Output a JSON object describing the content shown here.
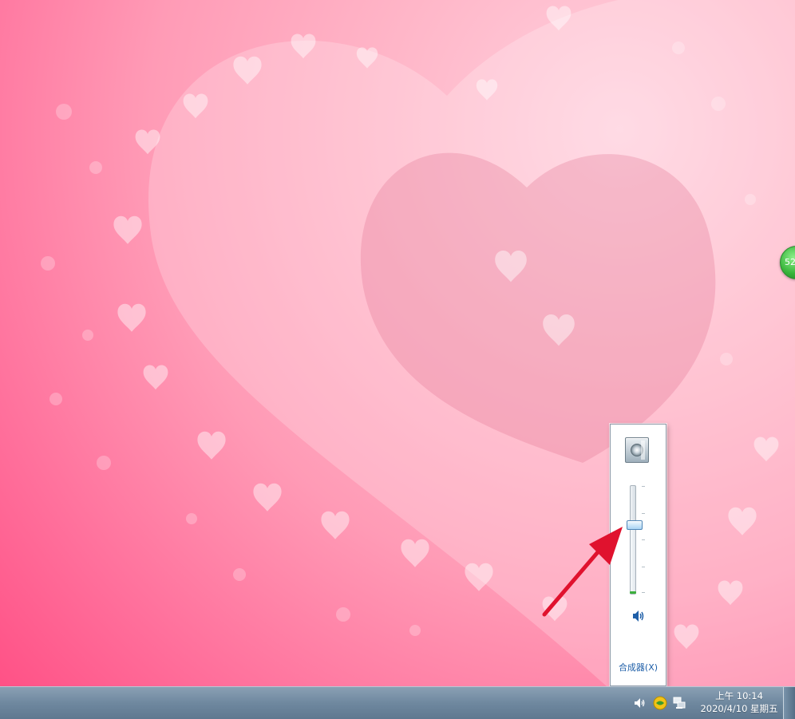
{
  "desktop": {
    "widget_text": "52"
  },
  "volume_popup": {
    "level": 0.65,
    "mixer_label": "合成器(X)"
  },
  "taskbar": {
    "clock_time": "上午 10:14",
    "clock_date": "2020/4/10 星期五"
  }
}
